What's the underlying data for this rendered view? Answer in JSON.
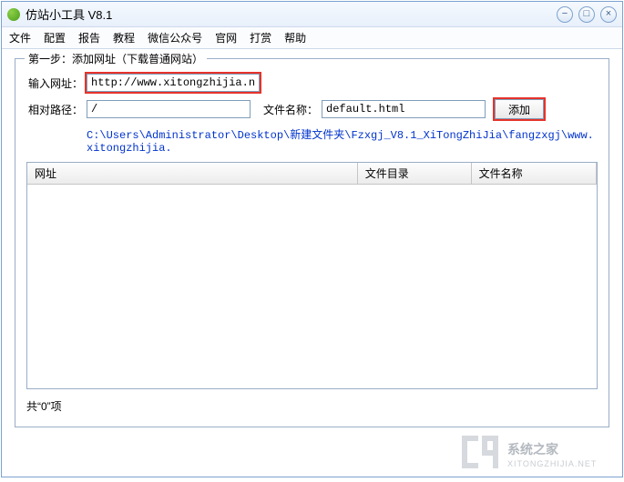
{
  "window": {
    "title": "仿站小工具 V8.1"
  },
  "menu": {
    "items": [
      "文件",
      "配置",
      "报告",
      "教程",
      "微信公众号",
      "官网",
      "打赏",
      "帮助"
    ]
  },
  "group": {
    "title": "第一步：添加网址（下载普通网站）",
    "url_label": "输入网址：",
    "url_value": "http://www.xitongzhijia.net/",
    "path_label": "相对路径：",
    "path_value": "/",
    "fname_label": "文件名称：",
    "fname_value": "default.html",
    "add_label": "添加",
    "full_path": "C:\\Users\\Administrator\\Desktop\\新建文件夹\\Fzxgj_V8.1_XiTongZhiJia\\fangzxgj\\www.xitongzhijia."
  },
  "table": {
    "headers": [
      "网址",
      "文件目录",
      "文件名称"
    ]
  },
  "count_text": "共“0”项",
  "watermark": {
    "brand": "系统之家",
    "sub": "XITONGZHIJIA.NET"
  }
}
